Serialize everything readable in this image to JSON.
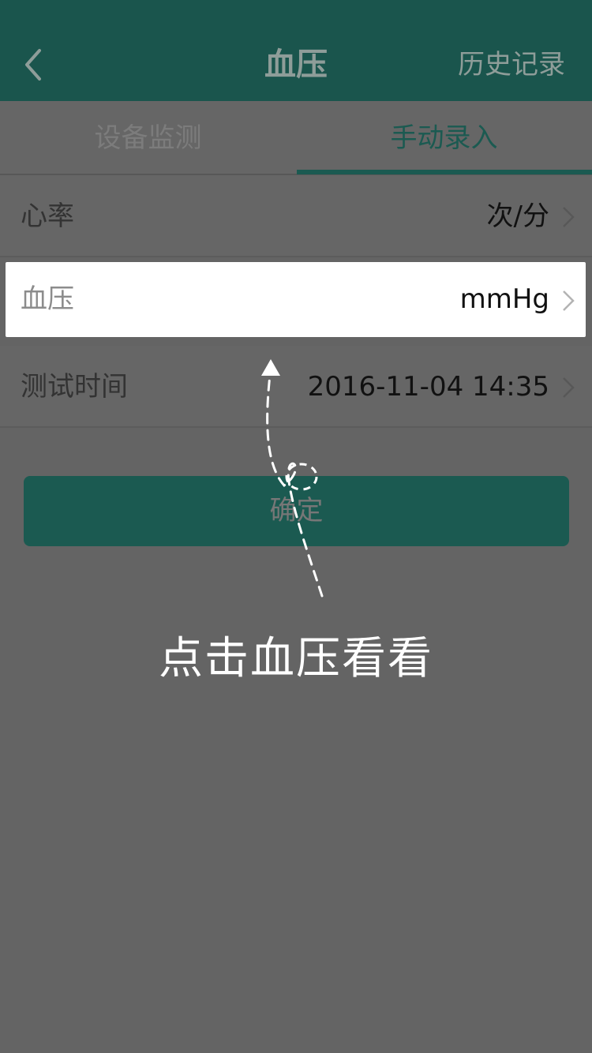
{
  "nav": {
    "title": "血压",
    "history_label": "历史记录",
    "back_icon": "chevron-left-icon"
  },
  "tabs": [
    {
      "label": "设备监测",
      "active": false
    },
    {
      "label": "手动录入",
      "active": true
    }
  ],
  "rows": {
    "heart_rate": {
      "label": "心率",
      "value": "次/分"
    },
    "blood_pressure": {
      "label": "血压",
      "value": "mmHg"
    },
    "test_time": {
      "label": "测试时间",
      "value": "2016-11-04 14:35"
    }
  },
  "confirm_label": "确定",
  "guide": {
    "text": "点击血压看看"
  },
  "colors": {
    "brand_teal": "#1a554d",
    "overlay_gray": "#646464",
    "highlight": "#ffffff"
  }
}
